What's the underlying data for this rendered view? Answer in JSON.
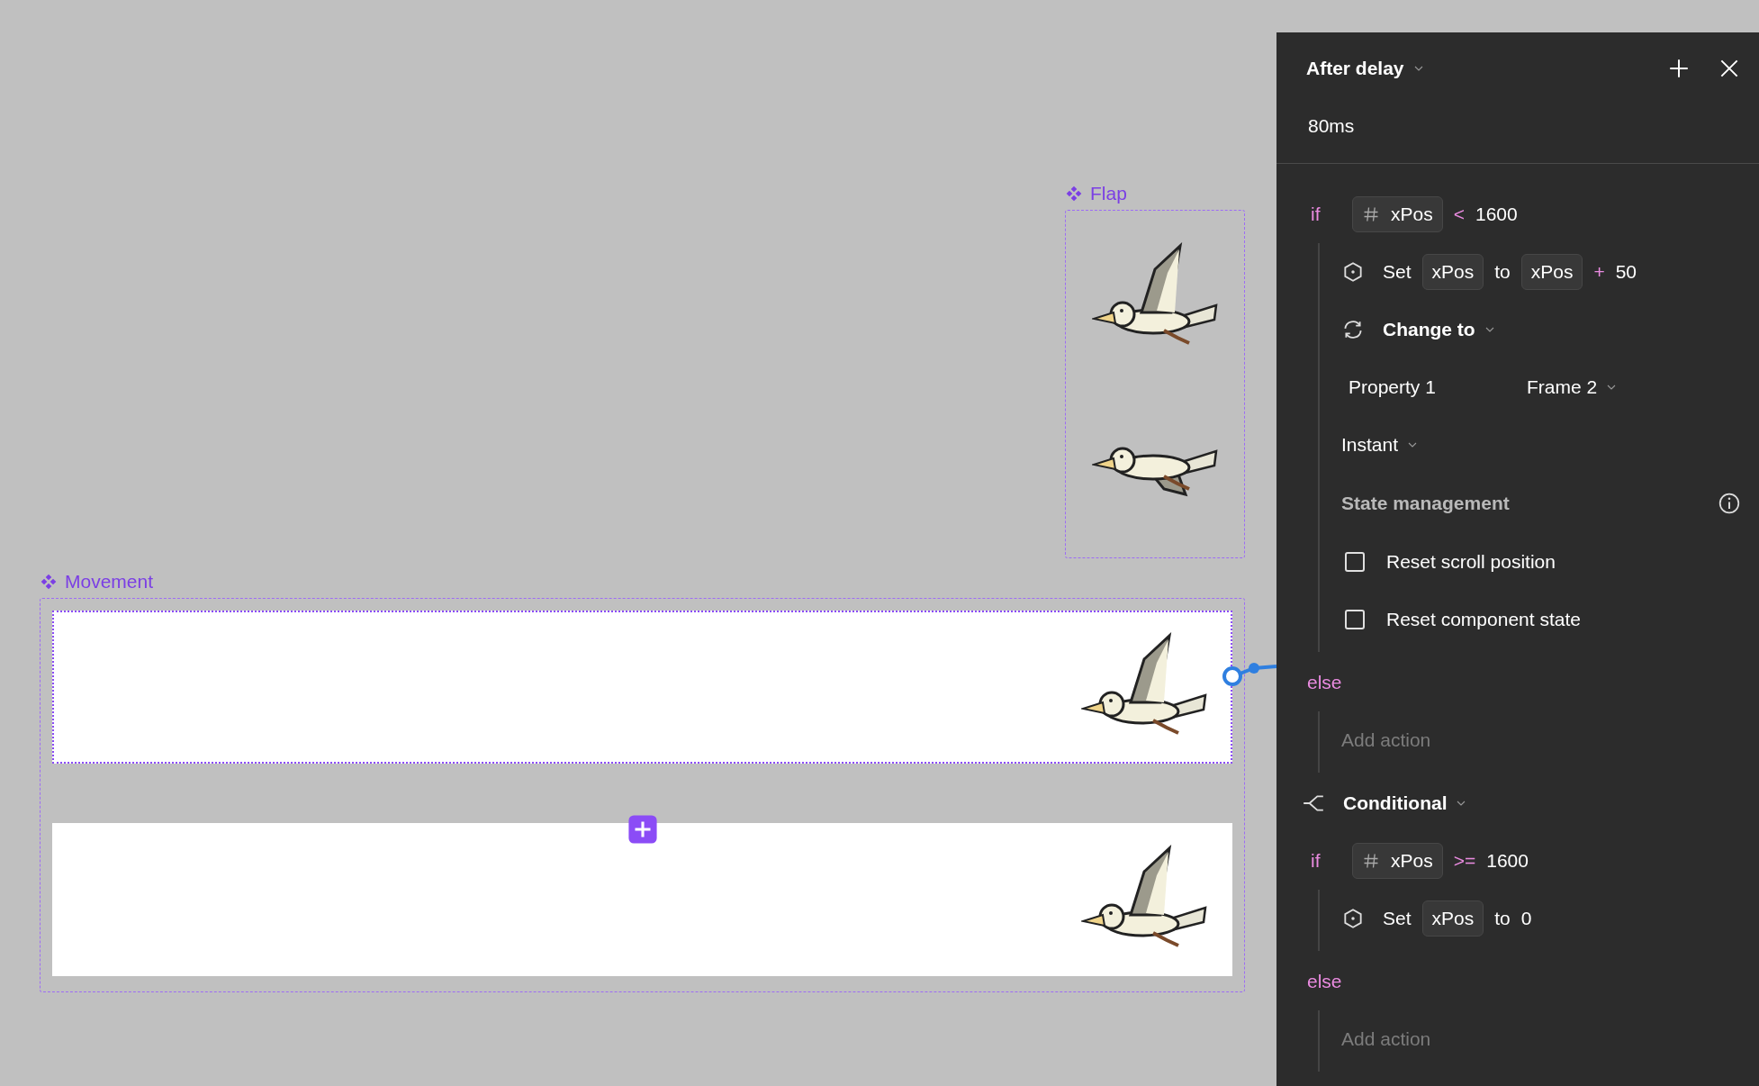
{
  "canvas": {
    "flap_component": {
      "label": "Flap",
      "frames": [
        {
          "kind": "wings-up"
        },
        {
          "kind": "wings-down"
        }
      ]
    },
    "movement_component": {
      "label": "Movement",
      "variants": [
        {
          "selected": true,
          "kind": "wings-up"
        },
        {
          "selected": false,
          "kind": "wings-up"
        }
      ]
    }
  },
  "panel": {
    "trigger": "After delay",
    "delay": "80ms",
    "blocks": [
      {
        "kind": "if",
        "keyword": "if",
        "variable": "xPos",
        "operator": "<",
        "value": "1600",
        "children": [
          {
            "kind": "set",
            "label": "Set",
            "target": "xPos",
            "to": "to",
            "source": "xPos",
            "operator": "+",
            "value": "50"
          },
          {
            "kind": "change",
            "label": "Change to"
          },
          {
            "kind": "property",
            "name": "Property 1",
            "value": "Frame 2"
          },
          {
            "kind": "transition",
            "label": "Instant"
          },
          {
            "kind": "heading",
            "label": "State management"
          },
          {
            "kind": "checkbox",
            "label": "Reset scroll position",
            "checked": false
          },
          {
            "kind": "checkbox",
            "label": "Reset component state",
            "checked": false
          }
        ]
      },
      {
        "kind": "else",
        "keyword": "else",
        "children": [
          {
            "kind": "placeholder",
            "label": "Add action"
          }
        ]
      },
      {
        "kind": "conditional",
        "label": "Conditional"
      },
      {
        "kind": "if",
        "keyword": "if",
        "variable": "xPos",
        "operator": ">=",
        "value": "1600",
        "children": [
          {
            "kind": "set",
            "label": "Set",
            "target": "xPos",
            "to": "to",
            "value": "0"
          }
        ]
      },
      {
        "kind": "else",
        "keyword": "else",
        "children": [
          {
            "kind": "placeholder",
            "label": "Add action"
          }
        ]
      }
    ]
  }
}
